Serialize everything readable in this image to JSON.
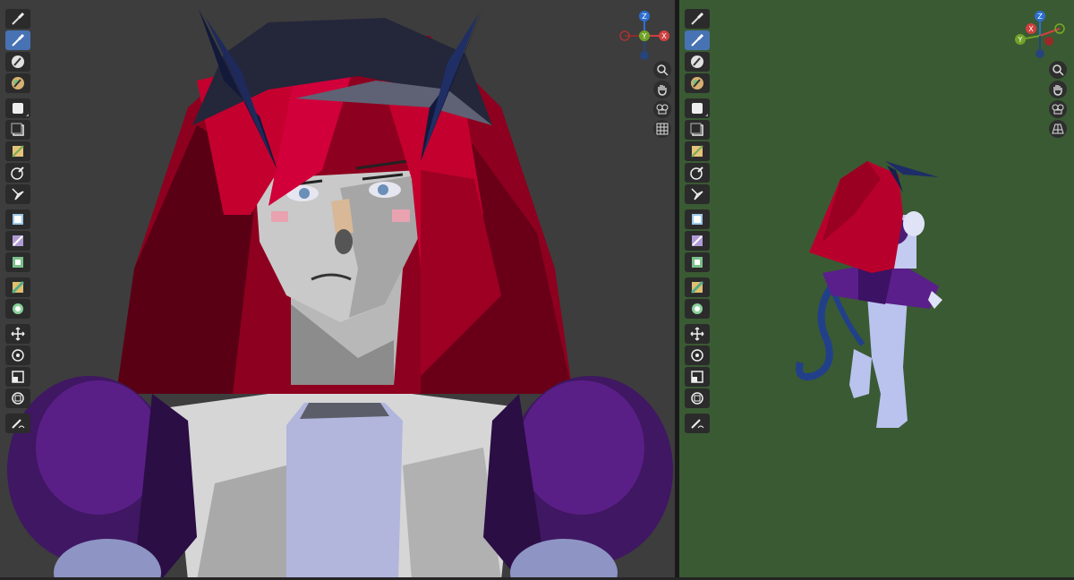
{
  "left_viewport": {
    "gizmo": {
      "x_label": "X",
      "y_label": "Y",
      "z_label": "Z"
    },
    "toolbar": [
      {
        "icon": "brush-icon",
        "active": false
      },
      {
        "icon": "draw-brush-icon",
        "active": true
      },
      {
        "icon": "soften-brush-icon",
        "active": false
      },
      {
        "icon": "smear-brush-icon",
        "active": false
      },
      {
        "icon": "clone-brush-icon",
        "active": false
      },
      {
        "icon": "fill-brush-icon",
        "active": false
      },
      {
        "icon": "mask-brush-icon",
        "active": false
      },
      {
        "icon": "gradient-icon",
        "active": false
      },
      {
        "icon": "sample-icon",
        "active": false
      },
      {
        "icon": "transform-icon",
        "active": false
      },
      {
        "icon": "annotate-icon",
        "active": false
      }
    ],
    "nav": [
      "zoom-icon",
      "pan-hand-icon",
      "camera-view-icon",
      "ortho-grid-icon"
    ]
  },
  "right_viewport": {
    "gizmo": {
      "x_label": "X",
      "y_label": "Y",
      "z_label": "Z"
    },
    "nav": [
      "zoom-icon",
      "pan-hand-icon",
      "camera-view-icon",
      "ortho-grid-icon"
    ]
  },
  "colors": {
    "left_background": "#3d3d3d",
    "right_background": "#3a5a33",
    "active_tool": "#4772b3",
    "hair": "#b8002c",
    "dress": "#4b1c72",
    "horn": "#1c2a5c",
    "skin": "#c8c8c8"
  }
}
